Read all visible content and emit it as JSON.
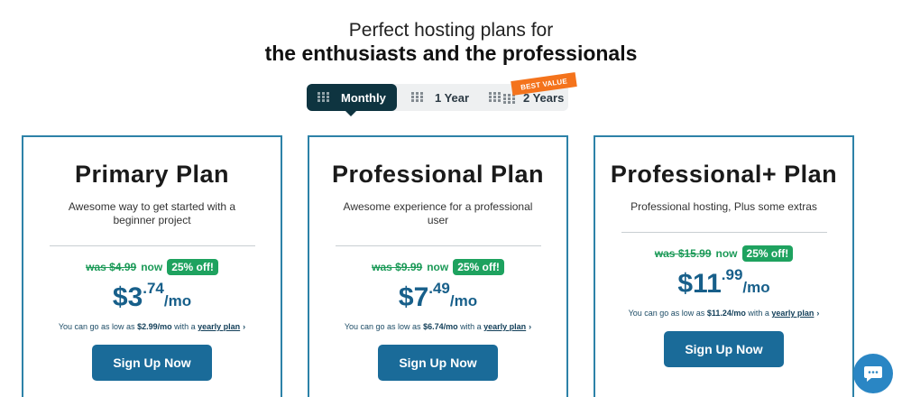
{
  "header": {
    "subtitle": "Perfect hosting plans for",
    "title": "the enthusiasts and the professionals"
  },
  "billing_tabs": [
    {
      "label": "Monthly",
      "active": true
    },
    {
      "label": "1 Year",
      "active": false
    },
    {
      "label": "2 Years",
      "active": false
    }
  ],
  "ribbon": "BEST VALUE",
  "plans": [
    {
      "name": "Primary Plan",
      "description": "Awesome way to get started with a beginner project",
      "was_price": "was $4.99",
      "now_label": "now",
      "discount": "25% off!",
      "currency": "$",
      "price_main": "3",
      "price_cents": ".74",
      "per": "/mo",
      "low_prefix": "You can go as low as",
      "low_price": "$2.99/mo",
      "low_with": "with a",
      "yearly_link": "yearly plan",
      "button": "Sign Up Now"
    },
    {
      "name": "Professional Plan",
      "description": "Awesome experience for a professional user",
      "was_price": "was $9.99",
      "now_label": "now",
      "discount": "25% off!",
      "currency": "$",
      "price_main": "7",
      "price_cents": ".49",
      "per": "/mo",
      "low_prefix": "You can go as low as",
      "low_price": "$6.74/mo",
      "low_with": "with a",
      "yearly_link": "yearly plan",
      "button": "Sign Up Now"
    },
    {
      "name": "Professional+ Plan",
      "description": "Professional hosting, Plus some extras",
      "was_price": "was $15.99",
      "now_label": "now",
      "discount": "25% off!",
      "currency": "$",
      "price_main": "11",
      "price_cents": ".99",
      "per": "/mo",
      "low_prefix": "You can go as low as",
      "low_price": "$11.24/mo",
      "low_with": "with a",
      "yearly_link": "yearly plan",
      "button": "Sign Up Now"
    }
  ],
  "icons": {
    "tab_icon": "grid-icon",
    "chevron": "chevron-right-icon",
    "chat": "chat-bubble-icon"
  },
  "colors": {
    "accent": "#1a6b99",
    "tab_active": "#0e3440",
    "discount": "#1ea25f",
    "ribbon": "#f4731c",
    "card_border": "#2d82a8"
  }
}
